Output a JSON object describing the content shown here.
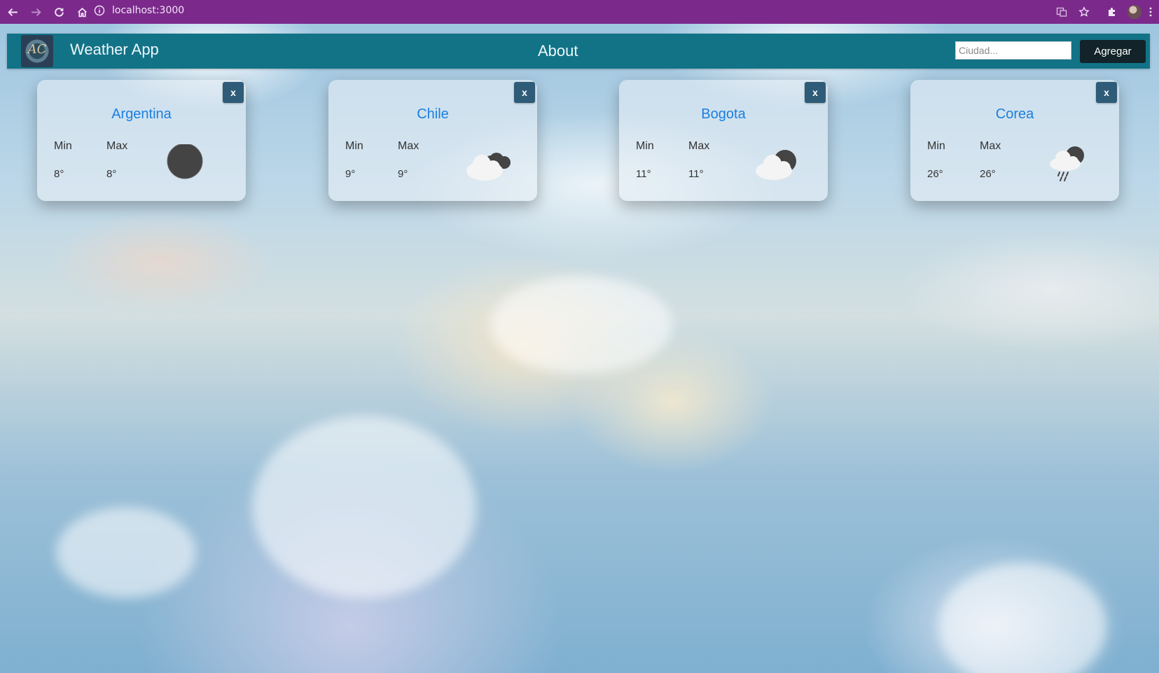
{
  "browser": {
    "url": "localhost:3000"
  },
  "app": {
    "brand": "Weather App",
    "about": "About",
    "search": {
      "placeholder": "Ciudad...",
      "value": ""
    },
    "add_label": "Agregar"
  },
  "cards": [
    {
      "city": "Argentina",
      "min_label": "Min",
      "max_label": "Max",
      "min": "8°",
      "max": "8°",
      "icon": "dark-circle-icon",
      "close": "x"
    },
    {
      "city": "Chile",
      "min_label": "Min",
      "max_label": "Max",
      "min": "9°",
      "max": "9°",
      "icon": "broken-clouds-icon",
      "close": "x"
    },
    {
      "city": "Bogota",
      "min_label": "Min",
      "max_label": "Max",
      "min": "11°",
      "max": "11°",
      "icon": "cloudy-icon",
      "close": "x"
    },
    {
      "city": "Corea",
      "min_label": "Min",
      "max_label": "Max",
      "min": "26°",
      "max": "26°",
      "icon": "rain-cloud-icon",
      "close": "x"
    }
  ],
  "colors": {
    "browser_bar": "#7b2a8c",
    "navbar": "#127387",
    "city_text": "#1a7fe0",
    "close_button": "#2e5b78",
    "add_button": "#12232a"
  }
}
